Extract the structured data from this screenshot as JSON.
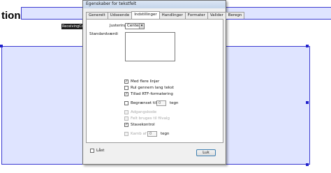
{
  "background": {
    "field_label": "tion:",
    "field_tag": "ReceivingCou"
  },
  "dialog": {
    "title": "Egenskaber for tekstfelt",
    "tabs": [
      "Generelt",
      "Udseende",
      "Indstillinger",
      "Handlinger",
      "Formater",
      "Valider",
      "Beregn"
    ],
    "active_tab": "Indstillinger",
    "justering_label": "Justering:",
    "justering_value": "Center",
    "standardvaerdi_label": "Standardværdi",
    "standardvaerdi_value": "",
    "options": [
      {
        "label": "Med flere linjer",
        "checked": true,
        "enabled": true
      },
      {
        "label": "Rul gennem lang tekst",
        "checked": false,
        "enabled": true
      },
      {
        "label": "Tillad RTF-formatering",
        "checked": true,
        "enabled": true
      },
      {
        "label": "Begrænset til",
        "checked": false,
        "enabled": true,
        "spin_value": "0",
        "suffix": "tegn"
      },
      {
        "label": "Adgangskode",
        "checked": false,
        "enabled": false
      },
      {
        "label": "Felt bruges til filvalg",
        "checked": false,
        "enabled": false
      },
      {
        "label": "Stavekontrol",
        "checked": true,
        "enabled": true
      },
      {
        "label": "Kamb af",
        "checked": false,
        "enabled": false,
        "spin_value": "0",
        "suffix": "tegn"
      }
    ],
    "locked_label": "Låst",
    "locked_checked": false,
    "close_label": "Luk"
  }
}
